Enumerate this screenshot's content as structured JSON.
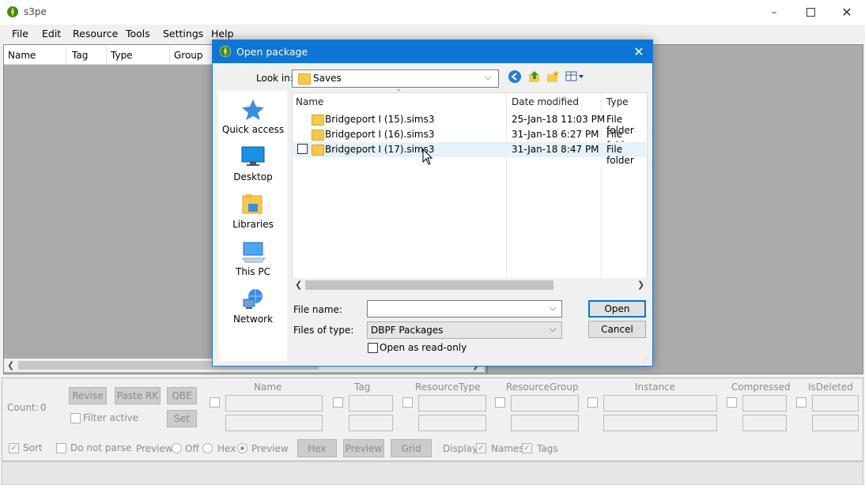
{
  "app": {
    "title": "s3pe"
  },
  "menu": [
    "File",
    "Edit",
    "Resource",
    "Tools",
    "Settings",
    "Help"
  ],
  "list": {
    "columns": [
      "Name",
      "Tag",
      "Type",
      "Group"
    ]
  },
  "bottom": {
    "count_label": "Count:",
    "count_value": "0",
    "revise": "Revise",
    "paste_rk": "Paste RK",
    "qbe": "QBE",
    "set": "Set",
    "filter_active": "Filter active",
    "fields": {
      "name": "Name",
      "tag": "Tag",
      "resource_type": "ResourceType",
      "resource_group": "ResourceGroup",
      "instance": "Instance",
      "compressed": "Compressed",
      "is_deleted": "IsDeleted"
    },
    "sort": "Sort",
    "do_not_parse": "Do not parse",
    "preview_label": "Preview:",
    "preview_off": "Off",
    "preview_hex": "Hex",
    "preview_preview": "Preview",
    "btn_hex": "Hex",
    "btn_preview": "Preview",
    "btn_grid": "Grid",
    "display_label": "Display:",
    "display_names": "Names",
    "display_tags": "Tags"
  },
  "dialog": {
    "title": "Open package",
    "look_in_label": "Look in:",
    "look_in_value": "Saves",
    "places": [
      "Quick access",
      "Desktop",
      "Libraries",
      "This PC",
      "Network"
    ],
    "columns": [
      "Name",
      "Date modified",
      "Type"
    ],
    "files": [
      {
        "name": "Bridgeport I (15).sims3",
        "date": "25-Jan-18 11:03 PM",
        "type": "File folder"
      },
      {
        "name": "Bridgeport I (16).sims3",
        "date": "31-Jan-18 6:27 PM",
        "type": "File folder"
      },
      {
        "name": "Bridgeport I (17).sims3",
        "date": "31-Jan-18 8:47 PM",
        "type": "File folder"
      }
    ],
    "file_name_label": "File name:",
    "file_name_value": "",
    "files_of_type_label": "Files of type:",
    "files_of_type_value": "DBPF Packages",
    "read_only_label": "Open as read-only",
    "open_button": "Open",
    "cancel_button": "Cancel"
  },
  "colors": {
    "accent": "#0f75d6",
    "selection": "#e5f1fb",
    "folder": "#f5c94b"
  }
}
